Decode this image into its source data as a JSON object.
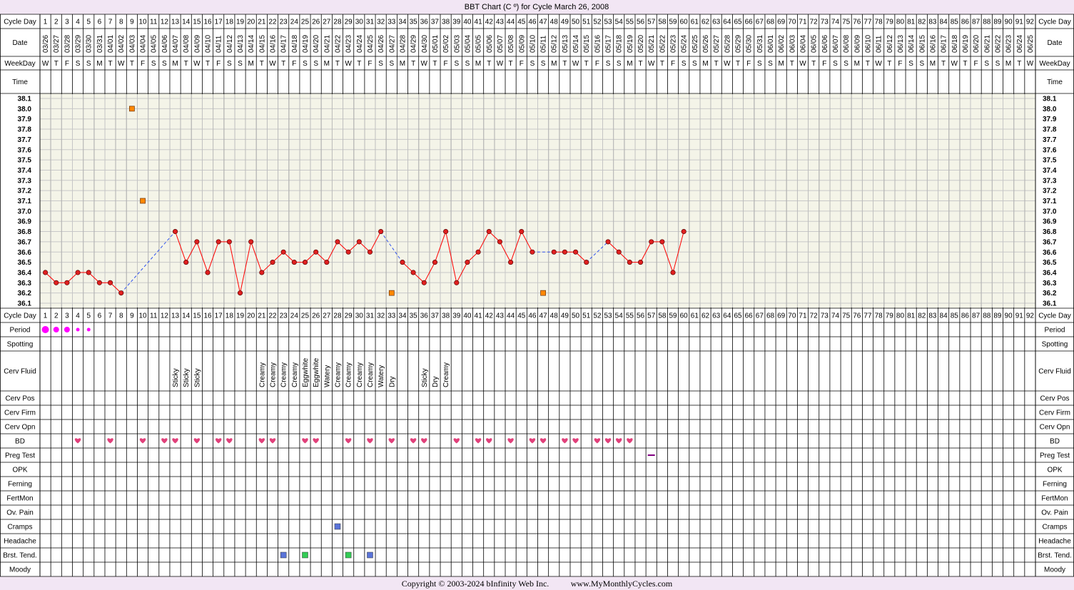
{
  "title": "BBT Chart (C º) for Cycle March 26, 2008",
  "copyright": "Copyright © 2003-2024 bInfinity Web Inc.",
  "website": "www.MyMonthlyCycles.com",
  "row_labels": {
    "cycle_day": "Cycle Day",
    "date": "Date",
    "weekday": "WeekDay",
    "time": "Time",
    "period": "Period",
    "spotting": "Spotting",
    "cerv_fluid": "Cerv Fluid",
    "cerv_pos": "Cerv Pos",
    "cerv_firm": "Cerv Firm",
    "cerv_opn": "Cerv Opn",
    "bd": "BD",
    "preg_test": "Preg Test",
    "opk": "OPK",
    "ferning": "Ferning",
    "fertmon": "FertMon",
    "ov_pain": "Ov. Pain",
    "cramps": "Cramps",
    "headache": "Headache",
    "brst_tend": "Brst. Tend.",
    "moody": "Moody"
  },
  "chart_data": {
    "type": "line",
    "title": "BBT Chart (C º) for Cycle March 26, 2008",
    "ylim": [
      36.1,
      38.1
    ],
    "y_ticks": [
      "38.1",
      "38.0",
      "37.9",
      "37.8",
      "37.7",
      "37.6",
      "37.5",
      "37.4",
      "37.3",
      "37.2",
      "37.1",
      "37.0",
      "36.9",
      "36.8",
      "36.7",
      "36.6",
      "36.5",
      "36.4",
      "36.3",
      "36.2",
      "36.1"
    ],
    "cycle_days": [
      1,
      2,
      3,
      4,
      5,
      6,
      7,
      8,
      9,
      10,
      11,
      12,
      13,
      14,
      15,
      16,
      17,
      18,
      19,
      20,
      21,
      22,
      23,
      24,
      25,
      26,
      27,
      28,
      29,
      30,
      31,
      32,
      33,
      34,
      35,
      36,
      37,
      38,
      39,
      40,
      41,
      42,
      43,
      44,
      45,
      46,
      47,
      48,
      49,
      50,
      51,
      52,
      53,
      54,
      55,
      56,
      57,
      58,
      59,
      60,
      61,
      62,
      63,
      64,
      65,
      66,
      67,
      68,
      69,
      70,
      71,
      72,
      73,
      74,
      75,
      76,
      77,
      78,
      79,
      80,
      81,
      82,
      83,
      84,
      85,
      86,
      87,
      88,
      89,
      90,
      91,
      92
    ],
    "dates": [
      "03/26",
      "03/27",
      "03/28",
      "03/29",
      "03/30",
      "03/31",
      "04/01",
      "04/02",
      "04/03",
      "04/04",
      "04/05",
      "04/06",
      "04/07",
      "04/08",
      "04/09",
      "04/10",
      "04/11",
      "04/12",
      "04/13",
      "04/14",
      "04/15",
      "04/16",
      "04/17",
      "04/18",
      "04/19",
      "04/20",
      "04/21",
      "04/22",
      "04/23",
      "04/24",
      "04/25",
      "04/26",
      "04/27",
      "04/28",
      "04/29",
      "04/30",
      "05/01",
      "05/02",
      "05/03",
      "05/04",
      "05/05",
      "05/06",
      "05/07",
      "05/08",
      "05/09",
      "05/10",
      "05/11",
      "05/12",
      "05/13",
      "05/14",
      "05/15",
      "05/16",
      "05/17",
      "05/18",
      "05/19",
      "05/20",
      "05/21",
      "05/22",
      "05/23",
      "05/24",
      "05/25",
      "05/26",
      "05/27",
      "05/28",
      "05/29",
      "05/30",
      "05/31",
      "06/01",
      "06/02",
      "06/03",
      "06/04",
      "06/05",
      "06/06",
      "06/07",
      "06/08",
      "06/09",
      "06/10",
      "06/11",
      "06/12",
      "06/13",
      "06/14",
      "06/15",
      "06/16",
      "06/17",
      "06/18",
      "06/19",
      "06/20",
      "06/21",
      "06/22",
      "06/23",
      "06/24",
      "06/25"
    ],
    "weekdays": [
      "W",
      "T",
      "F",
      "S",
      "S",
      "M",
      "T",
      "W",
      "T",
      "F",
      "S",
      "S",
      "M",
      "T",
      "W",
      "T",
      "F",
      "S",
      "S",
      "M",
      "T",
      "W",
      "T",
      "F",
      "S",
      "S",
      "M",
      "T",
      "W",
      "T",
      "F",
      "S",
      "S",
      "M",
      "T",
      "W",
      "T",
      "F",
      "S",
      "S",
      "M",
      "T",
      "W",
      "T",
      "F",
      "S",
      "S",
      "M",
      "T",
      "W",
      "T",
      "F",
      "S",
      "S",
      "M",
      "T",
      "W",
      "T",
      "F",
      "S",
      "S",
      "M",
      "T",
      "W",
      "T",
      "F",
      "S",
      "S",
      "M",
      "T",
      "W",
      "T",
      "F",
      "S",
      "S",
      "M",
      "T",
      "W",
      "T",
      "F",
      "S",
      "S",
      "M",
      "T",
      "W",
      "T",
      "F",
      "S",
      "S",
      "M",
      "T",
      "W"
    ],
    "series": [
      {
        "temps": [
          [
            1,
            36.4
          ],
          [
            2,
            36.3
          ],
          [
            3,
            36.3
          ],
          [
            4,
            36.4
          ],
          [
            5,
            36.4
          ],
          [
            6,
            36.3
          ],
          [
            7,
            36.3
          ],
          [
            8,
            36.2
          ],
          [
            13,
            36.8
          ],
          [
            14,
            36.5
          ],
          [
            15,
            36.7
          ],
          [
            16,
            36.4
          ],
          [
            17,
            36.7
          ],
          [
            18,
            36.7
          ],
          [
            19,
            36.2
          ],
          [
            20,
            36.7
          ],
          [
            21,
            36.4
          ],
          [
            22,
            36.5
          ],
          [
            23,
            36.6
          ],
          [
            24,
            36.5
          ],
          [
            25,
            36.5
          ],
          [
            26,
            36.6
          ],
          [
            27,
            36.5
          ],
          [
            28,
            36.7
          ],
          [
            29,
            36.6
          ],
          [
            30,
            36.7
          ],
          [
            31,
            36.6
          ],
          [
            32,
            36.8
          ],
          [
            34,
            36.5
          ],
          [
            35,
            36.4
          ],
          [
            36,
            36.3
          ],
          [
            37,
            36.5
          ],
          [
            38,
            36.8
          ],
          [
            39,
            36.3
          ],
          [
            40,
            36.5
          ],
          [
            41,
            36.6
          ],
          [
            42,
            36.8
          ],
          [
            43,
            36.7
          ],
          [
            44,
            36.5
          ],
          [
            45,
            36.8
          ],
          [
            46,
            36.6
          ],
          [
            48,
            36.6
          ],
          [
            49,
            36.6
          ],
          [
            50,
            36.6
          ],
          [
            51,
            36.5
          ],
          [
            53,
            36.7
          ],
          [
            54,
            36.6
          ],
          [
            55,
            36.5
          ],
          [
            56,
            36.5
          ],
          [
            57,
            36.7
          ],
          [
            58,
            36.7
          ],
          [
            59,
            36.4
          ],
          [
            60,
            36.8
          ]
        ],
        "discarded": [
          [
            9,
            38.0
          ],
          [
            10,
            37.1
          ],
          [
            33,
            36.2
          ],
          [
            47,
            36.2
          ]
        ]
      }
    ],
    "period": [
      [
        1,
        "heavy"
      ],
      [
        2,
        "medium"
      ],
      [
        3,
        "medium"
      ],
      [
        4,
        "light"
      ],
      [
        5,
        "light"
      ]
    ],
    "cerv_fluid": [
      [
        13,
        "Sticky"
      ],
      [
        14,
        "Sticky"
      ],
      [
        15,
        "Sticky"
      ],
      [
        21,
        "Creamy"
      ],
      [
        22,
        "Creamy"
      ],
      [
        23,
        "Creamy"
      ],
      [
        24,
        "Creamy"
      ],
      [
        25,
        "Eggwhite"
      ],
      [
        26,
        "Eggwhite"
      ],
      [
        27,
        "Watery"
      ],
      [
        28,
        "Creamy"
      ],
      [
        29,
        "Creamy"
      ],
      [
        30,
        "Creamy"
      ],
      [
        31,
        "Creamy"
      ],
      [
        32,
        "Watery"
      ],
      [
        33,
        "Dry"
      ],
      [
        36,
        "Sticky"
      ],
      [
        37,
        "Dry"
      ],
      [
        38,
        "Creamy"
      ]
    ],
    "bd_days": [
      4,
      7,
      10,
      12,
      13,
      15,
      17,
      18,
      21,
      22,
      25,
      26,
      29,
      31,
      33,
      35,
      36,
      39,
      41,
      42,
      44,
      46,
      47,
      49,
      50,
      52,
      53,
      54,
      55
    ],
    "preg_test": [
      [
        57,
        "negative"
      ]
    ],
    "cramps": [
      [
        28,
        "#5a74d9"
      ]
    ],
    "brst_tend": [
      [
        23,
        "#5a74d9"
      ],
      [
        25,
        "#33cc55"
      ],
      [
        29,
        "#33cc55"
      ],
      [
        31,
        "#5a74d9"
      ]
    ]
  },
  "colors": {
    "background": "#f2e6f4",
    "temp_line": "#ff0000",
    "temp_point": "#e02020",
    "discarded_point": "#ff8800",
    "period": "#ff00ff",
    "heart": "#e0407a",
    "grid": "#c8c8c8",
    "plot_bg": "#f4f4e8",
    "dashed": "#3355ee",
    "preg_neg": "#800080"
  }
}
